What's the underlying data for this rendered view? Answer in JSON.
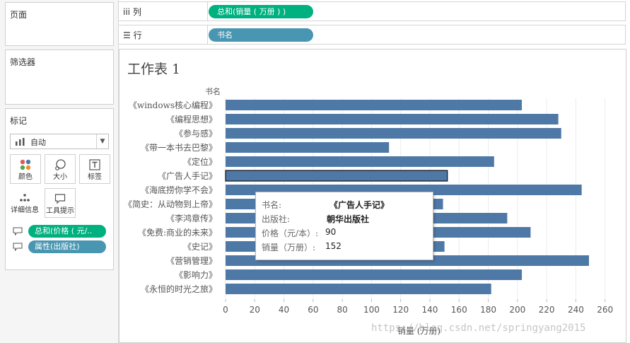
{
  "left_panel": {
    "pages_title": "页面",
    "filters_title": "筛选器",
    "marks_title": "标记",
    "mark_type": "自动",
    "buttons": [
      {
        "label": "颜色"
      },
      {
        "label": "大小"
      },
      {
        "label": "标签"
      },
      {
        "label": "详细信息"
      },
      {
        "label": "工具提示"
      }
    ],
    "mark_pills": [
      {
        "label": "总和(价格 ( 元/..",
        "color": "#00b180"
      },
      {
        "label": "属性(出版社)",
        "color": "#4996b2"
      }
    ]
  },
  "shelves": {
    "columns": {
      "icon": "iii",
      "label": "列",
      "pill": "总和(销量 ( 万册 ) )",
      "color": "#00b180"
    },
    "rows": {
      "icon": "☰",
      "label": "行",
      "pill": "书名",
      "color": "#4996b2"
    }
  },
  "sheet": {
    "title": "工作表 1"
  },
  "chart_data": {
    "type": "bar",
    "orientation": "horizontal",
    "ylabel": "书名",
    "xlabel": "销量 (万册)",
    "xlim": [
      0,
      265
    ],
    "xticks": [
      0,
      20,
      40,
      60,
      80,
      100,
      120,
      140,
      160,
      180,
      200,
      220,
      240,
      260
    ],
    "grid": true,
    "categories": [
      "《windows核心编程》",
      "《编程思想》",
      "《参与感》",
      "《带一本书去巴黎》",
      "《定位》",
      "《广告人手记》",
      "《海底捞你学不会》",
      "《简史：从动物到上帝》",
      "《李鸿章传》",
      "《免费:商业的未来》",
      "《史记》",
      "《营销管理》",
      "《影响力》",
      "《永恒的时光之旅》"
    ],
    "values": [
      203,
      228,
      230,
      112,
      184,
      152,
      244,
      149,
      193,
      209,
      150,
      249,
      203,
      182
    ],
    "bar_color": "#4e79a7",
    "highlighted_index": 5
  },
  "tooltip": {
    "rows": [
      {
        "key": "书名:",
        "value": "《广告人手记》",
        "bold": true
      },
      {
        "key": "出版社:",
        "value": "朝华出版社",
        "bold": true
      },
      {
        "key": "价格（元/本）:",
        "value": "90",
        "bold": false
      },
      {
        "key": "销量（万册）:",
        "value": "152",
        "bold": false
      }
    ]
  },
  "watermark": "https://blog.csdn.net/springyang2015"
}
